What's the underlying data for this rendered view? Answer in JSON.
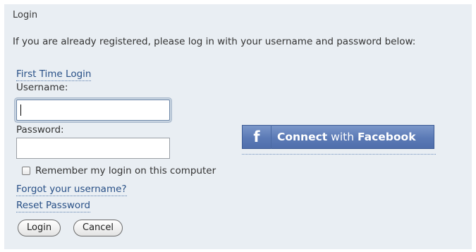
{
  "panel": {
    "title": "Login",
    "intro": "If you are already registered, please log in with your username and password below:"
  },
  "links": {
    "first_time_login": "First Time Login",
    "forgot_username": "Forgot your username?",
    "reset_password": "Reset Password"
  },
  "form": {
    "username_label": "Username:",
    "username_value": "",
    "password_label": "Password:",
    "password_value": "",
    "remember_label": "Remember my login on this computer",
    "remember_checked": false
  },
  "buttons": {
    "login": "Login",
    "cancel": "Cancel"
  },
  "facebook": {
    "icon": "facebook-f-icon",
    "connect": "Connect",
    "with": "with",
    "brand": "Facebook",
    "color": "#5b7ab6"
  },
  "colors": {
    "panel_bg": "#e9eef3",
    "link": "#274f86"
  }
}
